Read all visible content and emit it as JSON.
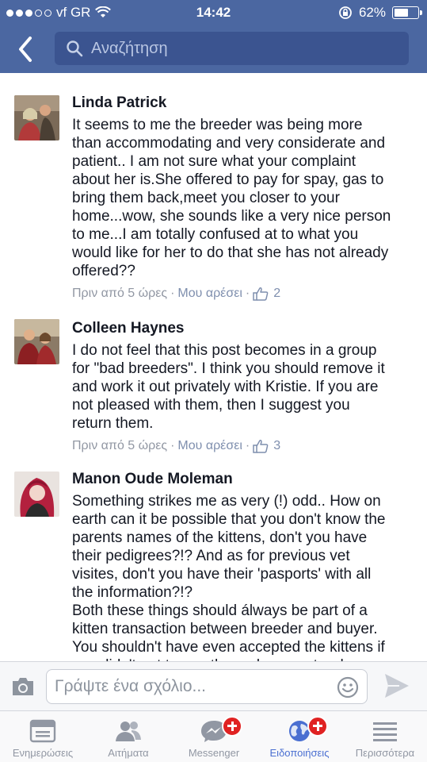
{
  "status_bar": {
    "carrier": "vf GR",
    "time": "14:42",
    "battery": "62%",
    "battery_level": 0.62
  },
  "nav": {
    "back_icon": "chevron-left-icon",
    "search_placeholder": "Αναζήτηση"
  },
  "comments": [
    {
      "author": "Linda Patrick",
      "text": "It seems to me the breeder was being more\nthan accommodating and very considerate and\npatient.. I am not sure what your complaint\nabout her is.She offered to pay for spay, gas to\nbring them back,meet you closer to your\nhome...wow, she sounds like a very nice person\nto me...I am totally confused at to what you\nwould like for her to do that she has not already\noffered??",
      "time": "Πριν από 5 ώρες",
      "like_label": "Μου αρέσει",
      "likes": "2"
    },
    {
      "author": "Colleen Haynes",
      "text": "I do not feel that this post becomes in a group\nfor \"bad breeders\". I think you should remove it\nand work it out privately with Kristie. If you are\nnot pleased with them, then I suggest you\nreturn them.",
      "time": "Πριν από 5 ώρες",
      "like_label": "Μου αρέσει",
      "likes": "3"
    },
    {
      "author": "Manon Oude Moleman",
      "text": "Something strikes me as very (!) odd..  How on\nearth can it be possible that you don't know the\nparents names of the kittens, don't you have\ntheir pedigrees?!? And as for previous vet\nvisites, don't you have their 'pasports' with all\nthe information?!?\nBoth these things should álways be part of a\nkitten transaction between breeder and buyer.\nYou shouldn't have even accepted the kittens if\nyou didn't get to see these documents when",
      "time": "",
      "like_label": "",
      "likes": ""
    }
  ],
  "composer": {
    "placeholder": "Γράψτε ένα σχόλιο..."
  },
  "tabs": [
    {
      "label": "Ενημερώσεις",
      "icon": "news-feed-icon",
      "active": false
    },
    {
      "label": "Αιτήματα",
      "icon": "friend-requests-icon",
      "active": false
    },
    {
      "label": "Messenger",
      "icon": "messenger-icon",
      "active": false,
      "badge": true
    },
    {
      "label": "Ειδοποιήσεις",
      "icon": "globe-icon",
      "active": true,
      "badge": true
    },
    {
      "label": "Περισσότερα",
      "icon": "menu-icon",
      "active": false
    }
  ],
  "colors": {
    "brand": "#4b67a1",
    "active_tab": "#4a6fd1",
    "badge": "#e02222"
  }
}
